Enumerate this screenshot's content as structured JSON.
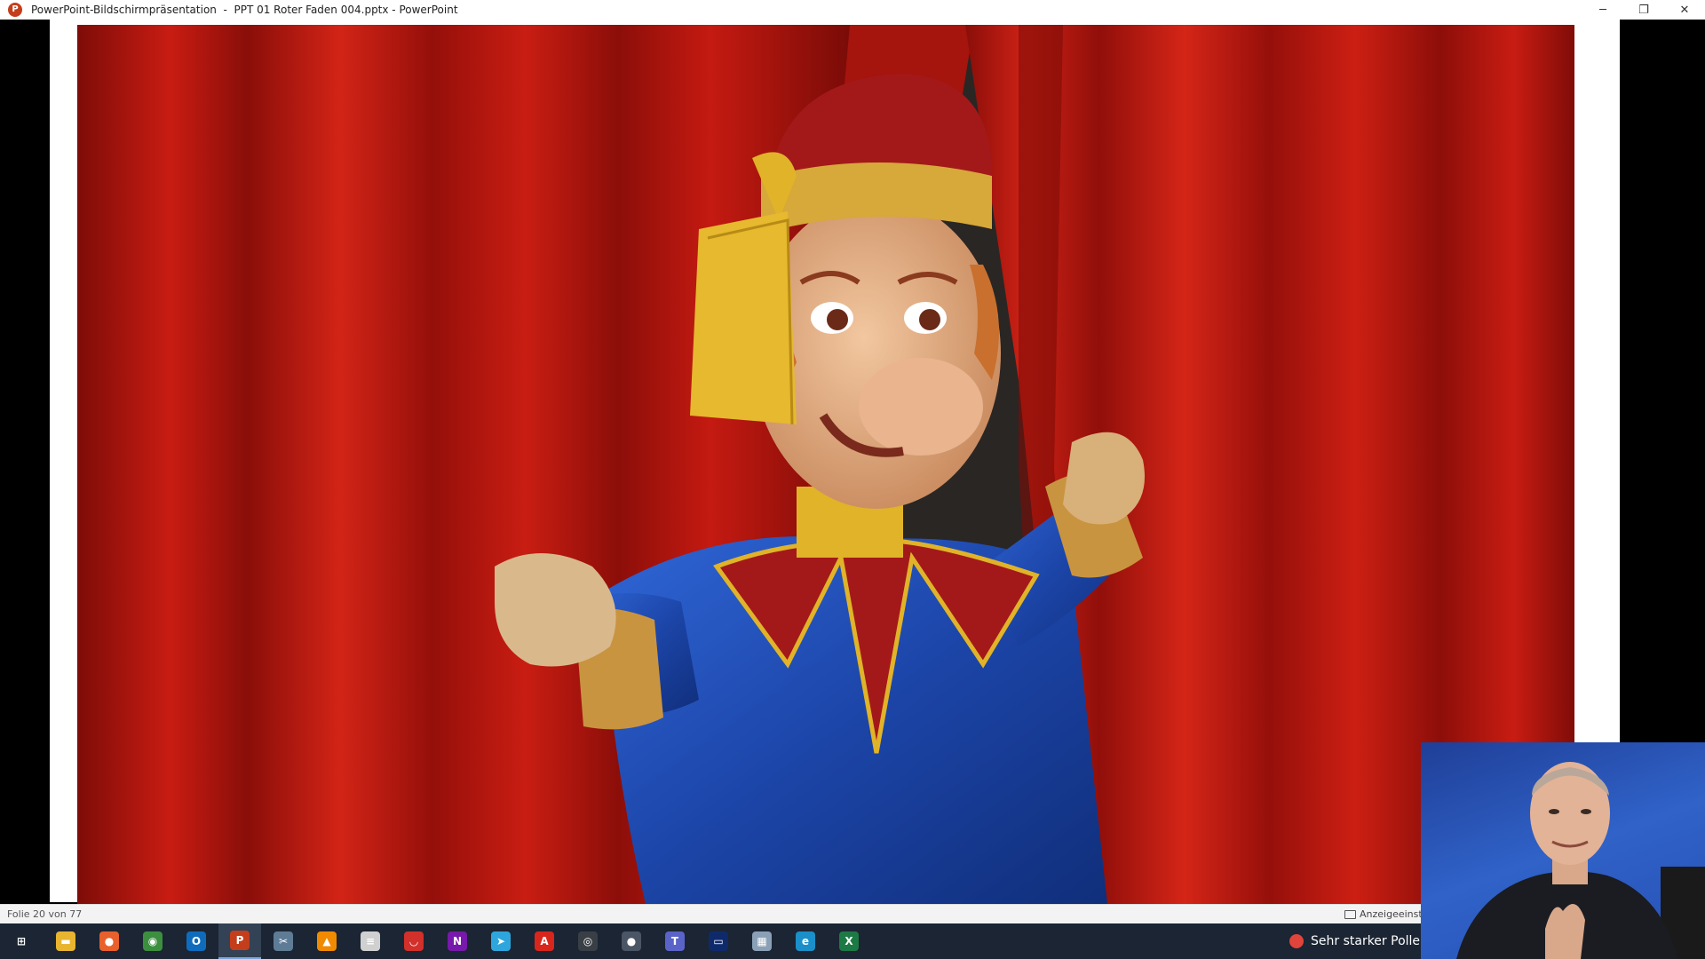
{
  "window": {
    "title": "PowerPoint-Bildschirmpräsentation  -  PPT 01 Roter Faden 004.pptx - PowerPoint",
    "app_icon": "powerpoint-icon",
    "controls": {
      "minimize": "─",
      "restore": "❐",
      "close": "✕"
    }
  },
  "status": {
    "slide_counter": "Folie 20 von 77",
    "display_settings": "Anzeigeeinste"
  },
  "taskbar": {
    "items": [
      {
        "name": "windows-start-icon",
        "glyph": "⊞",
        "color": "#1b2533"
      },
      {
        "name": "file-explorer-icon",
        "glyph": "▬",
        "color": "#e8b530"
      },
      {
        "name": "firefox-icon",
        "glyph": "●",
        "color": "#e8602c"
      },
      {
        "name": "chrome-icon",
        "glyph": "◉",
        "color": "#3c8f3f"
      },
      {
        "name": "outlook-icon",
        "glyph": "O",
        "color": "#0f6cbd"
      },
      {
        "name": "powerpoint-icon",
        "glyph": "P",
        "color": "#c43e1c"
      },
      {
        "name": "snipping-icon",
        "glyph": "✂",
        "color": "#5f7c96"
      },
      {
        "name": "vlc-icon",
        "glyph": "▲",
        "color": "#f08a00"
      },
      {
        "name": "notes-icon",
        "glyph": "≡",
        "color": "#d0d0d0"
      },
      {
        "name": "lips-app-icon",
        "glyph": "◡",
        "color": "#d2302a"
      },
      {
        "name": "onenote-icon",
        "glyph": "N",
        "color": "#7719aa"
      },
      {
        "name": "telegram-icon",
        "glyph": "➤",
        "color": "#2ea6dd"
      },
      {
        "name": "acrobat-icon",
        "glyph": "A",
        "color": "#d9261c"
      },
      {
        "name": "camera-app-icon",
        "glyph": "◎",
        "color": "#3a3f46"
      },
      {
        "name": "record-app-icon",
        "glyph": "●",
        "color": "#4a5566"
      },
      {
        "name": "teams-icon",
        "glyph": "T",
        "color": "#5a64c8"
      },
      {
        "name": "window-app-icon",
        "glyph": "▭",
        "color": "#0f2a6b"
      },
      {
        "name": "screen-app-icon",
        "glyph": "▦",
        "color": "#8aa0b6"
      },
      {
        "name": "edge-icon",
        "glyph": "e",
        "color": "#1b8fc9"
      },
      {
        "name": "excel-icon",
        "glyph": "X",
        "color": "#1d7a45"
      }
    ],
    "weather": {
      "icon": "pollen-icon",
      "label": "Sehr starker Pollen"
    }
  },
  "colors": {
    "curtain": "#b8150f",
    "shirt": "#1f4fb8",
    "hat": "#a3191a",
    "tassel": "#e0b328",
    "skin": "#e8b488"
  }
}
